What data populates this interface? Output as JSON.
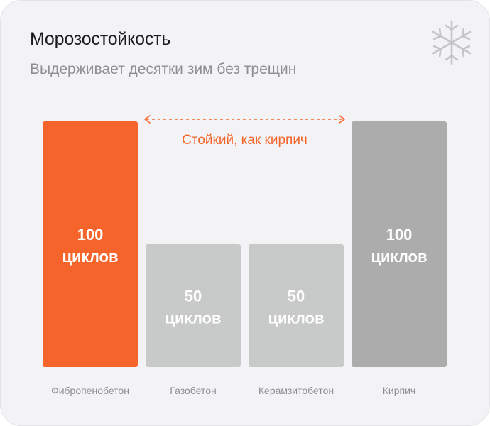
{
  "header": {
    "title": "Морозостойкость",
    "subtitle": "Выдерживает десятки зим без трещин",
    "icon": "snowflake-icon"
  },
  "colors": {
    "highlight": "#f5652b",
    "light_gray": "#c8c9c9",
    "dark_gray": "#acacac",
    "background": "#f3f3f5"
  },
  "chart_data": {
    "type": "bar",
    "title": "Морозостойкость",
    "subtitle": "Выдерживает десятки зим без трещин",
    "categories": [
      "Фибропенобетон",
      "Газобетон",
      "Керамзитобетон",
      "Кирпич"
    ],
    "values": [
      100,
      50,
      50,
      100
    ],
    "value_labels": [
      [
        "100",
        "циклов"
      ],
      [
        "50",
        "циклов"
      ],
      [
        "50",
        "циклов"
      ],
      [
        "100",
        "циклов"
      ]
    ],
    "bar_colors": [
      "#f5652b",
      "#c8c9c9",
      "#c8c9c9",
      "#acacac"
    ],
    "ylim": [
      0,
      100
    ],
    "grid": false,
    "annotation": {
      "text": "Стойкий, как кирпич",
      "from_category": 0,
      "to_category": 3,
      "color": "#f5652b"
    }
  }
}
